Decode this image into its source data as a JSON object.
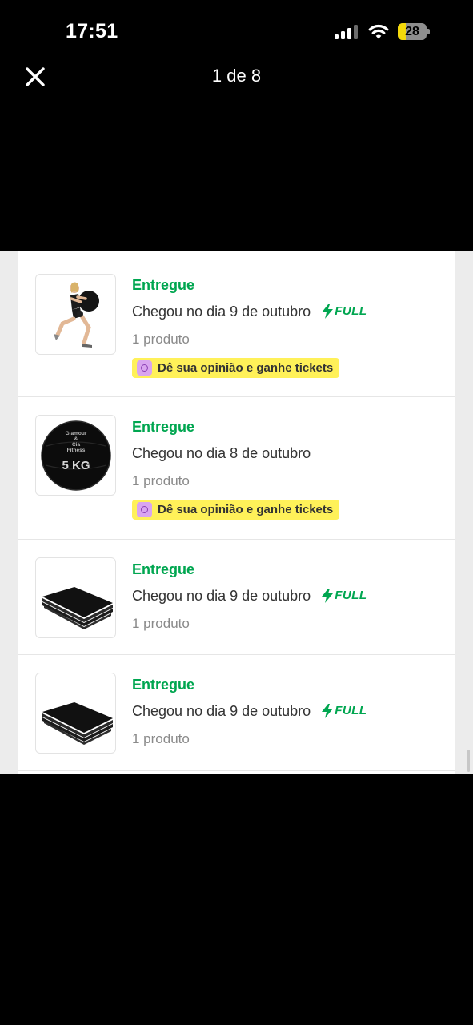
{
  "status_bar": {
    "time": "17:51",
    "battery": "28",
    "battery_level": 0.28
  },
  "viewer": {
    "counter": "1 de 8",
    "close_icon": "close-icon"
  },
  "orders": [
    {
      "status": "Entregue",
      "arrival": "Chegou no dia 9 de outubro",
      "full": "FULL",
      "qty": "1 produto",
      "review": "Dê sua opinião e ganhe tickets",
      "thumb": "woman-medicine-ball"
    },
    {
      "status": "Entregue",
      "arrival": "Chegou no dia 8 de outubro",
      "full": "",
      "qty": "1 produto",
      "review": "Dê sua opinião e ganhe tickets",
      "thumb": "medicine-ball",
      "ball_text": {
        "brand_line1": "Glamour",
        "brand_line2": "&",
        "brand_line3": "Cia",
        "brand_line4": "Fitness",
        "weight": "5 KG"
      }
    },
    {
      "status": "Entregue",
      "arrival": "Chegou no dia 9 de outubro",
      "full": "FULL",
      "qty": "1 produto",
      "review": "",
      "thumb": "black-mats"
    },
    {
      "status": "Entregue",
      "arrival": "Chegou no dia 9 de outubro",
      "full": "FULL",
      "qty": "1 produto",
      "review": "",
      "thumb": "black-mats"
    }
  ],
  "colors": {
    "green": "#00a650",
    "badge_yellow": "#fff159",
    "background": "#000000"
  }
}
